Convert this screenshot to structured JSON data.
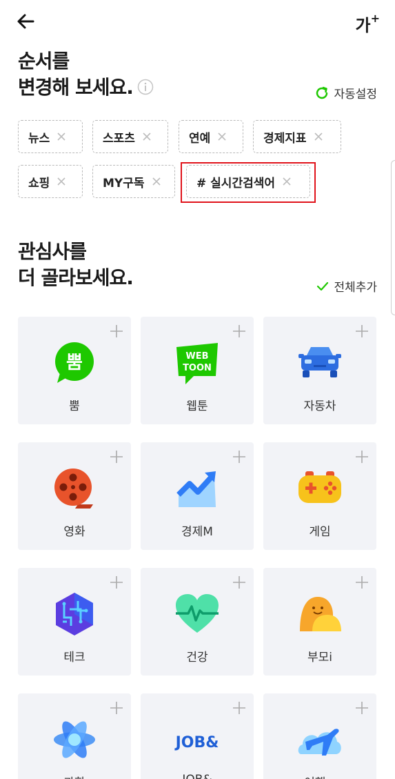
{
  "header": {
    "font_size_label": "가",
    "font_size_plus": "+"
  },
  "order": {
    "title_line1": "순서를",
    "title_line2": "변경해 보세요.",
    "auto_label": "자동설정"
  },
  "tabs": [
    {
      "label": "뉴스"
    },
    {
      "label": "스포츠"
    },
    {
      "label": "연예"
    },
    {
      "label": "경제지표"
    },
    {
      "label": "쇼핑"
    },
    {
      "label": "MY구독"
    },
    {
      "label": "# 실시간검색어"
    }
  ],
  "interests": {
    "title_line1": "관심사를",
    "title_line2": "더 골라보세요.",
    "add_all_label": "전체추가"
  },
  "cards": [
    {
      "label": "뿜",
      "icon": "bbum-icon"
    },
    {
      "label": "웹툰",
      "icon": "webtoon-icon"
    },
    {
      "label": "자동차",
      "icon": "car-icon"
    },
    {
      "label": "영화",
      "icon": "film-reel-icon"
    },
    {
      "label": "경제M",
      "icon": "economy-chart-icon"
    },
    {
      "label": "게임",
      "icon": "gamepad-icon"
    },
    {
      "label": "테크",
      "icon": "tech-chip-icon"
    },
    {
      "label": "건강",
      "icon": "heart-pulse-icon"
    },
    {
      "label": "부모i",
      "icon": "parent-child-icon"
    },
    {
      "label": "과학",
      "icon": "atom-icon"
    },
    {
      "label": "JOB&",
      "icon": "job-logo-icon"
    },
    {
      "label": "여행+",
      "icon": "airplane-cloud-icon"
    }
  ],
  "icon_text": {
    "bbum": "뿜",
    "webtoon_top": "WEB",
    "webtoon_bottom": "TOON",
    "job": "JOB&"
  },
  "colors": {
    "accent_green": "#1ec800",
    "highlight_red": "#e0121a",
    "card_bg": "#f2f3f7"
  }
}
